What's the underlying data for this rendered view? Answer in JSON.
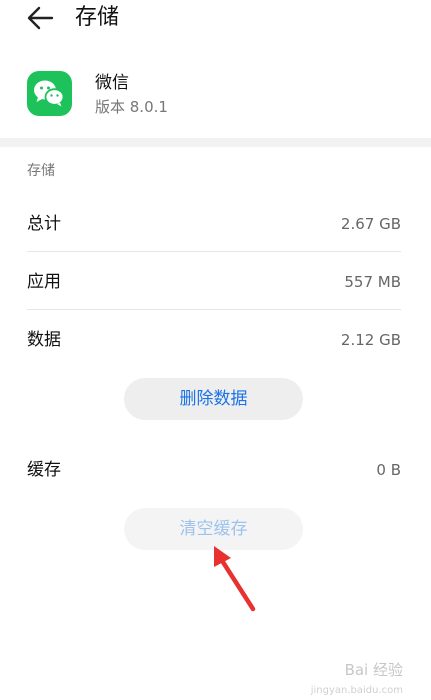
{
  "header": {
    "title": "存储",
    "back_icon": "arrow-left-icon"
  },
  "app": {
    "name": "微信",
    "version": "版本 8.0.1",
    "icon": "wechat-icon",
    "icon_color": "#1ec25a"
  },
  "storage": {
    "section_label": "存储",
    "rows": [
      {
        "label": "总计",
        "value": "2.67 GB"
      },
      {
        "label": "应用",
        "value": "557 MB"
      },
      {
        "label": "数据",
        "value": "2.12 GB"
      }
    ],
    "delete_button_label": "删除数据"
  },
  "cache": {
    "label": "缓存",
    "value": "0 B",
    "clear_button_label": "清空缓存"
  },
  "colors": {
    "accent": "#1a73e8",
    "disabled_accent": "#9cc2ee",
    "annotation": "#e8322f"
  },
  "watermark": {
    "text": "Bai 经验",
    "url": "jingyan.baidu.com"
  }
}
